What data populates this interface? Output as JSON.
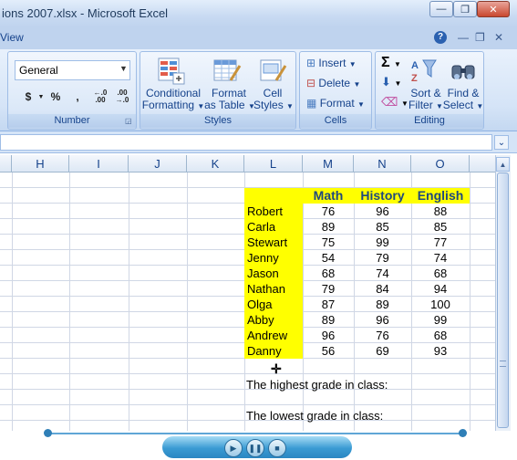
{
  "window": {
    "title": "ions 2007.xlsx - Microsoft Excel",
    "min": "—",
    "max": "❐",
    "close": "✕"
  },
  "ribbon": {
    "tab_view": "View",
    "help_icon": "?",
    "sub_min": "—",
    "sub_restore": "❐",
    "sub_close": "✕",
    "number": {
      "format_value": "General",
      "currency": "$",
      "percent": "%",
      "comma": ",",
      "inc_decimal": "←.0 .00",
      "dec_decimal": ".00 →.0",
      "label": "Number"
    },
    "styles": {
      "conditional": "Conditional Formatting",
      "conditional_l1": "Conditional",
      "conditional_l2": "Formatting",
      "format_table_l1": "Format",
      "format_table_l2": "as Table",
      "cell_styles_l1": "Cell",
      "cell_styles_l2": "Styles",
      "label": "Styles"
    },
    "cells": {
      "insert": "Insert",
      "delete": "Delete",
      "format": "Format",
      "label": "Cells"
    },
    "editing": {
      "sort_l1": "Sort &",
      "sort_l2": "Filter",
      "find_l1": "Find &",
      "find_l2": "Select",
      "label": "Editing"
    }
  },
  "columns": [
    "H",
    "I",
    "J",
    "K",
    "L",
    "M",
    "N",
    "O"
  ],
  "table": {
    "headers": [
      "Math",
      "History",
      "English"
    ],
    "rows": [
      {
        "name": "Robert",
        "math": "76",
        "history": "96",
        "english": "88"
      },
      {
        "name": "Carla",
        "math": "89",
        "history": "85",
        "english": "85"
      },
      {
        "name": "Stewart",
        "math": "75",
        "history": "99",
        "english": "77"
      },
      {
        "name": "Jenny",
        "math": "54",
        "history": "79",
        "english": "74"
      },
      {
        "name": "Jason",
        "math": "68",
        "history": "74",
        "english": "68"
      },
      {
        "name": "Nathan",
        "math": "79",
        "history": "84",
        "english": "94"
      },
      {
        "name": "Olga",
        "math": "87",
        "history": "89",
        "english": "100"
      },
      {
        "name": "Abby",
        "math": "89",
        "history": "96",
        "english": "99"
      },
      {
        "name": "Andrew",
        "math": "96",
        "history": "76",
        "english": "68"
      },
      {
        "name": "Danny",
        "math": "56",
        "history": "69",
        "english": "93"
      }
    ],
    "highest_label": "The highest grade in class:",
    "lowest_label": "The lowest grade in class:"
  },
  "colors": {
    "highlight": "#ffff00",
    "header_text": "#1f497d"
  }
}
